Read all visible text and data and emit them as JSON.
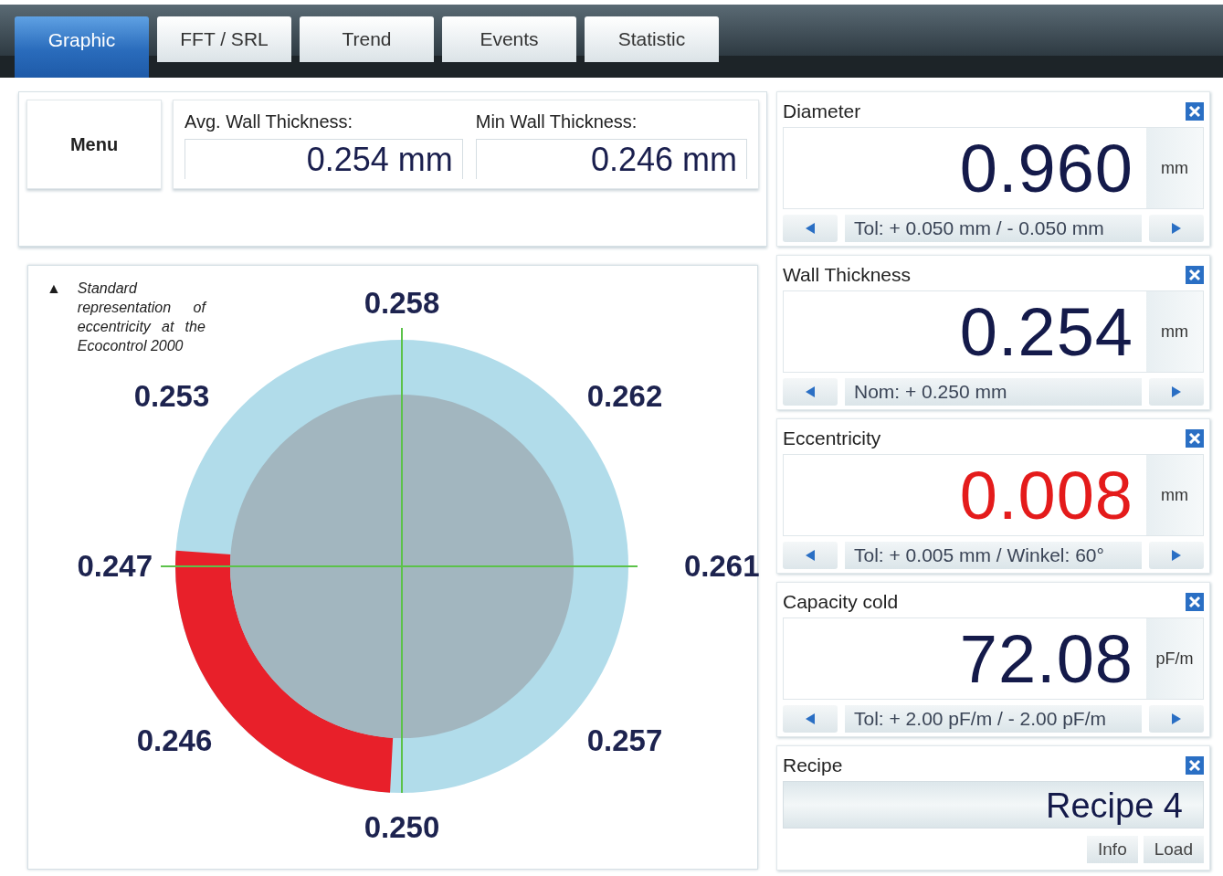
{
  "tabs": [
    {
      "label": "Graphic",
      "selected": true
    },
    {
      "label": "FFT / SRL",
      "selected": false
    },
    {
      "label": "Trend",
      "selected": false
    },
    {
      "label": "Events",
      "selected": false
    },
    {
      "label": "Statistic",
      "selected": false
    }
  ],
  "menu_button": "Menu",
  "summary": [
    {
      "label": "Avg. Wall Thickness:",
      "value": "0.254 mm"
    },
    {
      "label": "Min Wall Thickness:",
      "value": "0.246 mm"
    }
  ],
  "diagram": {
    "marker": "▲",
    "note": "Standard representation of eccentricity at the Ecocontrol 2000",
    "readings": [
      "0.258",
      "0.262",
      "0.261",
      "0.257",
      "0.250",
      "0.246",
      "0.247",
      "0.253"
    ]
  },
  "panels": [
    {
      "kind": "measurement",
      "title": "Diameter",
      "value": "0.960",
      "unit": "mm",
      "alarm": false,
      "info": "Tol: + 0.050 mm / - 0.050 mm"
    },
    {
      "kind": "measurement",
      "title": "Wall Thickness",
      "value": "0.254",
      "unit": "mm",
      "alarm": false,
      "info": "Nom: + 0.250 mm"
    },
    {
      "kind": "measurement",
      "title": "Eccentricity",
      "value": "0.008",
      "unit": "mm",
      "alarm": true,
      "info": "Tol: + 0.005 mm / Winkel: 60°"
    },
    {
      "kind": "measurement",
      "title": "Capacity cold",
      "value": "72.08",
      "unit": "pF/m",
      "alarm": false,
      "info": "Tol: + 2.00 pF/m / - 2.00 pF/m"
    },
    {
      "kind": "recipe",
      "title": "Recipe",
      "value": "Recipe 4",
      "buttons": [
        "Info",
        "Load"
      ]
    }
  ]
}
